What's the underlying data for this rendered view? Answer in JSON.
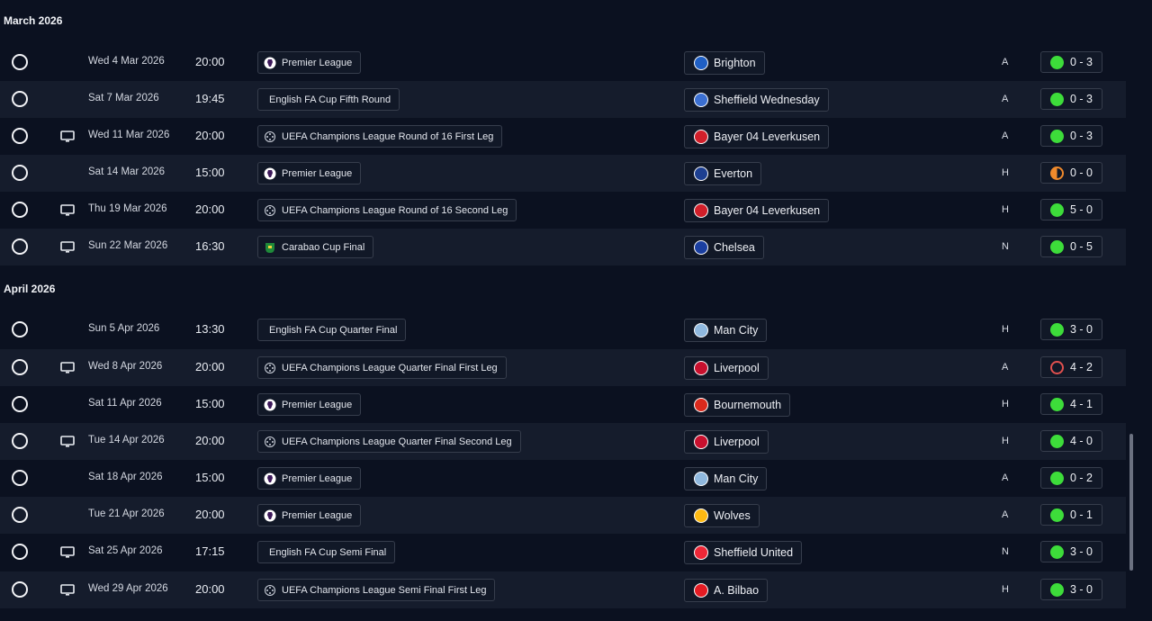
{
  "months": [
    {
      "label": "March 2026",
      "fixtures": [
        {
          "tv": false,
          "date": "Wed 4 Mar 2026",
          "time": "20:00",
          "competition": "Premier League",
          "comp_icon": "premier-league-icon",
          "opponent": "Brighton",
          "crest_color": "#1f5fc4",
          "venue": "A",
          "result": "0 - 3",
          "outcome": "win"
        },
        {
          "tv": false,
          "date": "Sat 7 Mar 2026",
          "time": "19:45",
          "competition": "English FA Cup Fifth Round",
          "comp_icon": "",
          "opponent": "Sheffield Wednesday",
          "crest_color": "#3b6fd1",
          "venue": "A",
          "result": "0 - 3",
          "outcome": "win"
        },
        {
          "tv": true,
          "date": "Wed 11 Mar 2026",
          "time": "20:00",
          "competition": "UEFA Champions League Round of 16  First Leg",
          "comp_icon": "champions-league-icon",
          "opponent": "Bayer 04 Leverkusen",
          "crest_color": "#d11f2a",
          "venue": "A",
          "result": "0 - 3",
          "outcome": "win"
        },
        {
          "tv": false,
          "date": "Sat 14 Mar 2026",
          "time": "15:00",
          "competition": "Premier League",
          "comp_icon": "premier-league-icon",
          "opponent": "Everton",
          "crest_color": "#1d3f91",
          "venue": "H",
          "result": "0 - 0",
          "outcome": "draw"
        },
        {
          "tv": true,
          "date": "Thu 19 Mar 2026",
          "time": "20:00",
          "competition": "UEFA Champions League Round of 16  Second Leg",
          "comp_icon": "champions-league-icon",
          "opponent": "Bayer 04 Leverkusen",
          "crest_color": "#d11f2a",
          "venue": "H",
          "result": "5 - 0",
          "outcome": "win"
        },
        {
          "tv": true,
          "date": "Sun 22 Mar 2026",
          "time": "16:30",
          "competition": "Carabao Cup Final",
          "comp_icon": "carabao-cup-icon",
          "opponent": "Chelsea",
          "crest_color": "#1b3fa0",
          "venue": "N",
          "result": "0 - 5",
          "outcome": "win"
        }
      ]
    },
    {
      "label": "April 2026",
      "fixtures": [
        {
          "tv": false,
          "date": "Sun 5 Apr 2026",
          "time": "13:30",
          "competition": "English FA Cup Quarter Final",
          "comp_icon": "",
          "opponent": "Man City",
          "crest_color": "#8fb8de",
          "venue": "H",
          "result": "3 - 0",
          "outcome": "win"
        },
        {
          "tv": true,
          "date": "Wed 8 Apr 2026",
          "time": "20:00",
          "competition": "UEFA Champions League Quarter Final First Leg",
          "comp_icon": "champions-league-icon",
          "opponent": "Liverpool",
          "crest_color": "#c8102e",
          "venue": "A",
          "result": "4 - 2",
          "outcome": "loss"
        },
        {
          "tv": false,
          "date": "Sat 11 Apr 2026",
          "time": "15:00",
          "competition": "Premier League",
          "comp_icon": "premier-league-icon",
          "opponent": "Bournemouth",
          "crest_color": "#da291c",
          "venue": "H",
          "result": "4 - 1",
          "outcome": "win"
        },
        {
          "tv": true,
          "date": "Tue 14 Apr 2026",
          "time": "20:00",
          "competition": "UEFA Champions League Quarter Final Second Leg",
          "comp_icon": "champions-league-icon",
          "opponent": "Liverpool",
          "crest_color": "#c8102e",
          "venue": "H",
          "result": "4 - 0",
          "outcome": "win"
        },
        {
          "tv": false,
          "date": "Sat 18 Apr 2026",
          "time": "15:00",
          "competition": "Premier League",
          "comp_icon": "premier-league-icon",
          "opponent": "Man City",
          "crest_color": "#8fb8de",
          "venue": "A",
          "result": "0 - 2",
          "outcome": "win"
        },
        {
          "tv": false,
          "date": "Tue 21 Apr 2026",
          "time": "20:00",
          "competition": "Premier League",
          "comp_icon": "premier-league-icon",
          "opponent": "Wolves",
          "crest_color": "#fdb913",
          "venue": "A",
          "result": "0 - 1",
          "outcome": "win"
        },
        {
          "tv": true,
          "date": "Sat 25 Apr 2026",
          "time": "17:15",
          "competition": "English FA Cup Semi Final",
          "comp_icon": "",
          "opponent": "Sheffield United",
          "crest_color": "#ee2737",
          "venue": "N",
          "result": "3 - 0",
          "outcome": "win"
        },
        {
          "tv": true,
          "date": "Wed 29 Apr 2026",
          "time": "20:00",
          "competition": "UEFA Champions League Semi Final First Leg",
          "comp_icon": "champions-league-icon",
          "opponent": "A. Bilbao",
          "crest_color": "#e41b23",
          "venue": "H",
          "result": "3 - 0",
          "outcome": "win"
        }
      ]
    }
  ]
}
